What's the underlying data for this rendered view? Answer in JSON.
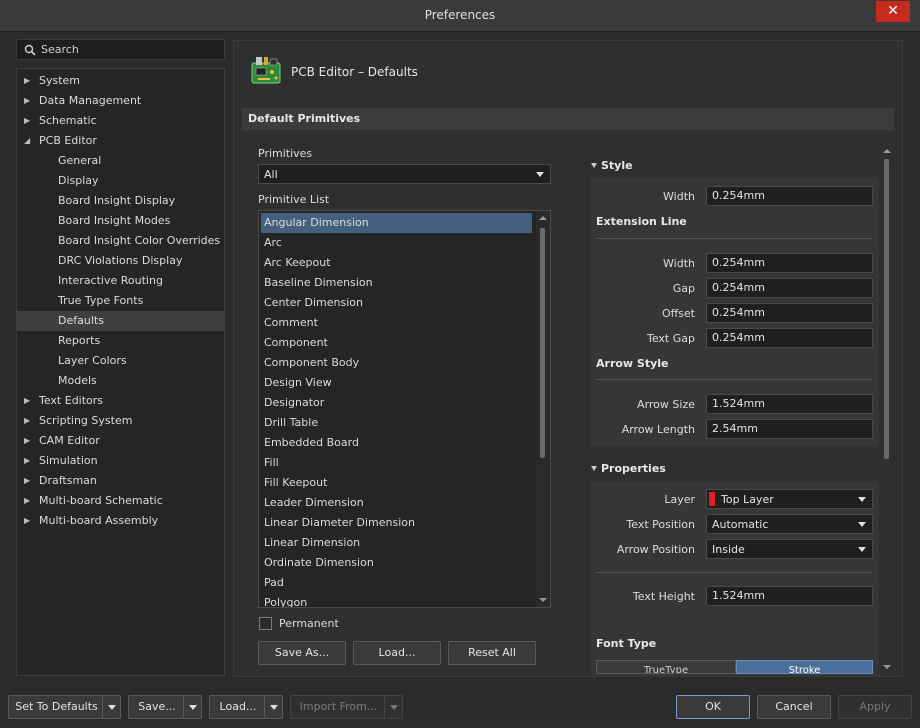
{
  "window": {
    "title": "Preferences",
    "close_glyph": "✕"
  },
  "search": {
    "label": "Search"
  },
  "tree": [
    {
      "label": "System",
      "level": 0,
      "expandable": true
    },
    {
      "label": "Data Management",
      "level": 0,
      "expandable": true
    },
    {
      "label": "Schematic",
      "level": 0,
      "expandable": true
    },
    {
      "label": "PCB Editor",
      "level": 0,
      "expandable": true,
      "expanded": true
    },
    {
      "label": "General",
      "level": 1
    },
    {
      "label": "Display",
      "level": 1
    },
    {
      "label": "Board Insight Display",
      "level": 1
    },
    {
      "label": "Board Insight Modes",
      "level": 1
    },
    {
      "label": "Board Insight Color Overrides",
      "level": 1
    },
    {
      "label": "DRC Violations Display",
      "level": 1
    },
    {
      "label": "Interactive Routing",
      "level": 1
    },
    {
      "label": "True Type Fonts",
      "level": 1
    },
    {
      "label": "Defaults",
      "level": 1,
      "selected": true
    },
    {
      "label": "Reports",
      "level": 1
    },
    {
      "label": "Layer Colors",
      "level": 1
    },
    {
      "label": "Models",
      "level": 1
    },
    {
      "label": "Text Editors",
      "level": 0,
      "expandable": true
    },
    {
      "label": "Scripting System",
      "level": 0,
      "expandable": true
    },
    {
      "label": "CAM Editor",
      "level": 0,
      "expandable": true
    },
    {
      "label": "Simulation",
      "level": 0,
      "expandable": true
    },
    {
      "label": "Draftsman",
      "level": 0,
      "expandable": true
    },
    {
      "label": "Multi-board Schematic",
      "level": 0,
      "expandable": true
    },
    {
      "label": "Multi-board Assembly",
      "level": 0,
      "expandable": true
    }
  ],
  "panel": {
    "title": "PCB Editor – Defaults",
    "section": "Default Primitives",
    "primitives_label": "Primitives",
    "primitives_value": "All",
    "list_label": "Primitive List",
    "list": [
      "Angular Dimension",
      "Arc",
      "Arc Keepout",
      "Baseline Dimension",
      "Center Dimension",
      "Comment",
      "Component",
      "Component Body",
      "Design View",
      "Designator",
      "Drill Table",
      "Embedded Board",
      "Fill",
      "Fill Keepout",
      "Leader Dimension",
      "Linear Diameter Dimension",
      "Linear Dimension",
      "Ordinate Dimension",
      "Pad",
      "Polygon"
    ],
    "selected_index": 0,
    "permanent_label": "Permanent",
    "buttons": {
      "save_as": "Save As...",
      "load": "Load...",
      "reset_all": "Reset All"
    }
  },
  "style": {
    "title": "Style",
    "width_label": "Width",
    "width": "0.254mm",
    "extension_title": "Extension Line",
    "ext_width_label": "Width",
    "ext_width": "0.254mm",
    "gap_label": "Gap",
    "gap": "0.254mm",
    "offset_label": "Offset",
    "offset": "0.254mm",
    "text_gap_label": "Text Gap",
    "text_gap": "0.254mm",
    "arrow_title": "Arrow Style",
    "arrow_size_label": "Arrow Size",
    "arrow_size": "1.524mm",
    "arrow_length_label": "Arrow Length",
    "arrow_length": "2.54mm"
  },
  "properties": {
    "title": "Properties",
    "layer_label": "Layer",
    "layer": "Top Layer",
    "layer_color": "#e02020",
    "text_position_label": "Text Position",
    "text_position": "Automatic",
    "arrow_position_label": "Arrow Position",
    "arrow_position": "Inside",
    "text_height_label": "Text Height",
    "text_height": "1.524mm",
    "font_type_title": "Font Type",
    "font_truetype": "TrueType",
    "font_stroke": "Stroke"
  },
  "footer": {
    "set_defaults": "Set To Defaults",
    "save": "Save...",
    "load": "Load...",
    "import_from": "Import From...",
    "ok": "OK",
    "cancel": "Cancel",
    "apply": "Apply"
  }
}
